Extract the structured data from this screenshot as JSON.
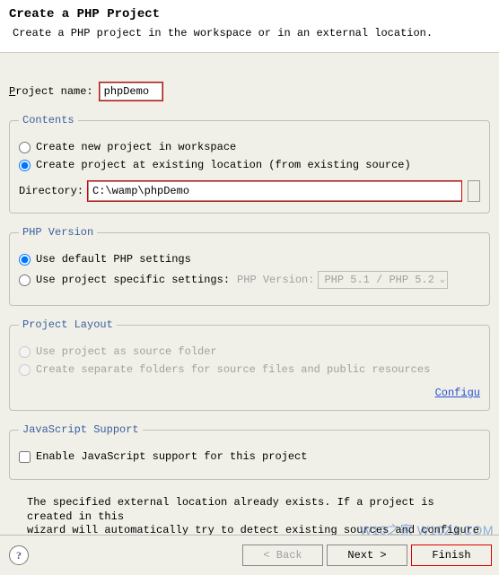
{
  "header": {
    "title": "Create a PHP Project",
    "subtitle": "Create a PHP project in the workspace or in an external location."
  },
  "project_name": {
    "label_pre": "P",
    "label_rest": "roject name:",
    "value": "phpDemo"
  },
  "contents": {
    "legend": "Contents",
    "opt_workspace": "Create new project in workspace",
    "opt_existing": "Create project at existing location (from existing source)",
    "selected": "existing",
    "directory_label_pre": "D",
    "directory_label_rest": "irectory:",
    "directory_value": "C:\\wamp\\phpDemo"
  },
  "php_version": {
    "legend": "PHP Version",
    "opt_default": "Use default PHP settings",
    "opt_specific": "Use project specific settings:",
    "selected": "default",
    "version_label": "PHP Version:",
    "version_value": "PHP 5.1 / PHP 5.2"
  },
  "project_layout": {
    "legend": "Project Layout",
    "opt_source": "Use project as source folder",
    "opt_separate": "Create separate folders for source files and public resources",
    "link": "Configu"
  },
  "js_support": {
    "legend": "JavaScript Support",
    "checkbox_label": "Enable JavaScript support for this project",
    "checked": false
  },
  "info_text": "The specified external location already exists. If a project is created in this\nwizard will automatically try to detect existing sources and configure the buil\nappropriately.",
  "buttons": {
    "back": "< Back",
    "next": "Next >",
    "finish": "Finish"
  },
  "watermark": "W10之家 W10ZJ.COM"
}
